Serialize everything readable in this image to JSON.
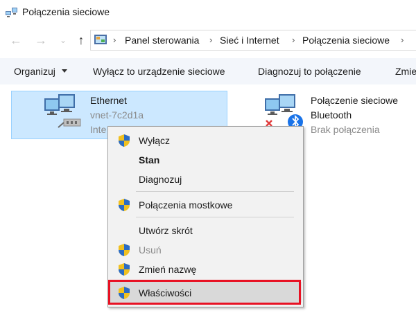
{
  "window": {
    "title": "Połączenia sieciowe"
  },
  "breadcrumb": [
    "Panel sterowania",
    "Sieć i Internet",
    "Połączenia sieciowe"
  ],
  "toolbar": {
    "organize": "Organizuj",
    "disable_device": "Wyłącz to urządzenie sieciowe",
    "diagnose": "Diagnozuj to połączenie",
    "rename_partial": "Zmie"
  },
  "connections": [
    {
      "name": "Ethernet",
      "network": "vnet-7c2d1a",
      "device_partial": "Inte"
    },
    {
      "name_line1": "Połączenie sieciowe",
      "name_line2": "Bluetooth",
      "status": "Brak połączenia"
    }
  ],
  "context_menu": {
    "items": [
      {
        "label": "Wyłącz",
        "shield": true,
        "style": "normal"
      },
      {
        "label": "Stan",
        "shield": false,
        "style": "bold"
      },
      {
        "label": "Diagnozuj",
        "shield": false,
        "style": "normal"
      },
      {
        "label": "Połączenia mostkowe",
        "shield": true,
        "style": "normal"
      },
      {
        "label": "Utwórz skrót",
        "shield": false,
        "style": "normal"
      },
      {
        "label": "Usuń",
        "shield": true,
        "style": "disabled"
      },
      {
        "label": "Zmień nazwę",
        "shield": true,
        "style": "normal"
      },
      {
        "label": "Właściwości",
        "shield": true,
        "style": "highlighted"
      }
    ]
  },
  "colors": {
    "selection_bg": "#cce8ff",
    "selection_border": "#99d1ff",
    "toolbar_bg": "#f3f6fb",
    "menu_bg": "#f2f2f2",
    "highlight_frame": "#e81123",
    "bluetooth_badge": "#1a73e8"
  }
}
